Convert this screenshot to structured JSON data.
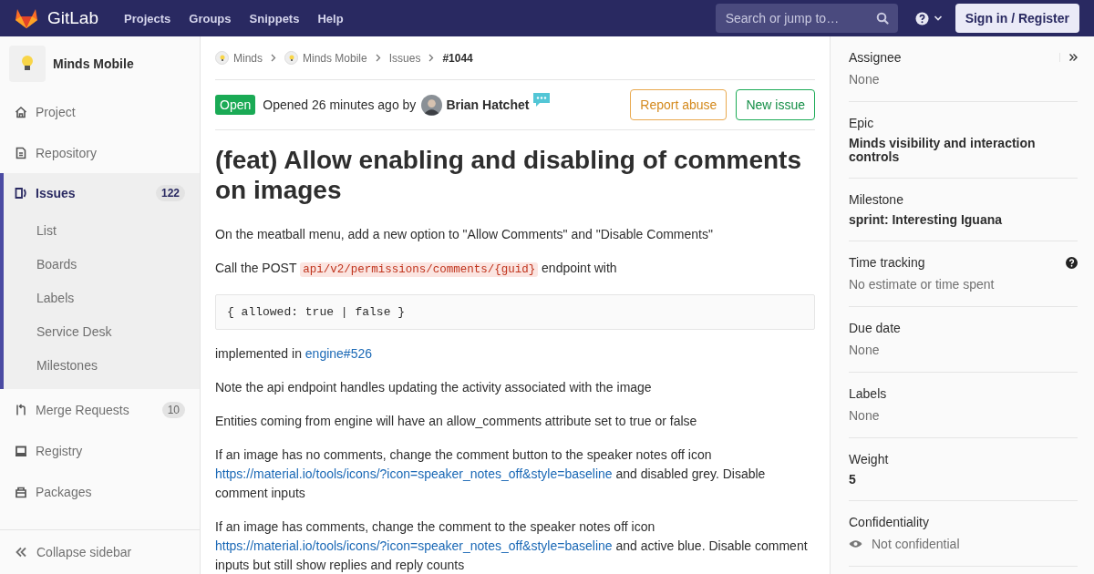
{
  "topbar": {
    "brand": "GitLab",
    "nav": [
      "Projects",
      "Groups",
      "Snippets",
      "Help"
    ],
    "search": {
      "placeholder": "Search or jump to…"
    },
    "sign_in": "Sign in / Register"
  },
  "sidebar": {
    "project": "Minds Mobile",
    "items": [
      {
        "label": "Project",
        "selected": false
      },
      {
        "label": "Repository",
        "selected": false
      },
      {
        "label": "Issues",
        "selected": true,
        "count": "122",
        "children": [
          {
            "label": "List"
          },
          {
            "label": "Boards"
          },
          {
            "label": "Labels"
          },
          {
            "label": "Service Desk"
          },
          {
            "label": "Milestones"
          }
        ]
      },
      {
        "label": "Merge Requests",
        "selected": false,
        "count": "10"
      },
      {
        "label": "Registry",
        "selected": false
      },
      {
        "label": "Packages",
        "selected": false
      }
    ],
    "collapse": "Collapse sidebar"
  },
  "breadcrumbs": [
    {
      "label": "Minds",
      "kind": "group"
    },
    {
      "label": "Minds Mobile",
      "kind": "group"
    },
    {
      "label": "Issues",
      "kind": "link"
    },
    {
      "label": "#1044",
      "kind": "current"
    }
  ],
  "issue": {
    "status": "Open",
    "opened": "Opened 26 minutes ago by",
    "author": "Brian Hatchet",
    "buttons": [
      {
        "label": "Report abuse",
        "kind": "warning"
      },
      {
        "label": "New issue",
        "kind": "success"
      }
    ],
    "title": "(feat) Allow enabling and disabling of comments on images",
    "body": [
      {
        "kind": "para",
        "parts": [
          {
            "kind": "text",
            "text": "On the meatball menu, add a new option to \"Allow Comments\" and \"Disable Comments\""
          }
        ]
      },
      {
        "kind": "para",
        "parts": [
          {
            "kind": "text",
            "text": "Call the POST "
          },
          {
            "kind": "code",
            "text": "api/v2/permissions/comments/{guid}"
          },
          {
            "kind": "text",
            "text": " endpoint with"
          }
        ]
      },
      {
        "kind": "codeblock",
        "text": "{ allowed: true | false }"
      },
      {
        "kind": "para",
        "parts": [
          {
            "kind": "text",
            "text": "implemented in "
          },
          {
            "kind": "link",
            "text": "engine#526"
          }
        ]
      },
      {
        "kind": "para",
        "parts": [
          {
            "kind": "text",
            "text": "Note the api endpoint handles updating the activity associated with the image"
          }
        ]
      },
      {
        "kind": "para",
        "parts": [
          {
            "kind": "text",
            "text": "Entities coming from engine will have an allow_comments attribute set to true or false"
          }
        ]
      },
      {
        "kind": "para",
        "parts": [
          {
            "kind": "text",
            "text": "If an image has no comments, change the comment button to the speaker notes off icon "
          },
          {
            "kind": "link",
            "text": "https://material.io/tools/icons/?icon=speaker_notes_off&style=baseline"
          },
          {
            "kind": "text",
            "text": " and disabled grey. Disable comment inputs"
          }
        ]
      },
      {
        "kind": "para",
        "parts": [
          {
            "kind": "text",
            "text": "If an image has comments, change the comment to the speaker notes off icon "
          },
          {
            "kind": "link",
            "text": "https://material.io/tools/icons/?icon=speaker_notes_off&style=baseline"
          },
          {
            "kind": "text",
            "text": " and active blue. Disable comment inputs but still show replies and reply counts"
          }
        ]
      }
    ]
  },
  "right_sidebar": [
    {
      "label": "Assignee",
      "value": "None",
      "kind": "muted"
    },
    {
      "label": "Epic",
      "value": "Minds visibility and interaction controls",
      "kind": "bold"
    },
    {
      "label": "Milestone",
      "value": "sprint: Interesting Iguana",
      "kind": "bold"
    },
    {
      "label": "Time tracking",
      "value": "No estimate or time spent",
      "kind": "help"
    },
    {
      "label": "Due date",
      "value": "None",
      "kind": "muted"
    },
    {
      "label": "Labels",
      "value": "None",
      "kind": "muted"
    },
    {
      "label": "Weight",
      "value": "5",
      "kind": "bold"
    },
    {
      "label": "Confidentiality",
      "value": "Not confidential",
      "kind": "eye"
    }
  ]
}
